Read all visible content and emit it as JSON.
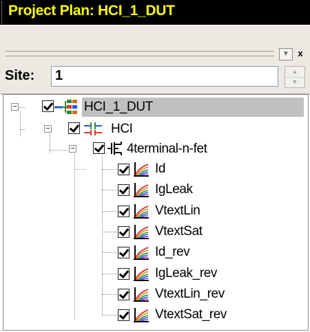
{
  "window": {
    "title": "Project Plan: HCI_1_DUT"
  },
  "dock": {
    "pin_glyph": "▼",
    "close_glyph": "x"
  },
  "site": {
    "label": "Site:",
    "value": "1"
  },
  "tree": {
    "root": {
      "label": "HCI_1_DUT",
      "checked": true,
      "expanded": true,
      "icon": "project-tree-icon"
    },
    "child": {
      "label": "HCI",
      "checked": true,
      "expanded": true,
      "icon": "module-icon"
    },
    "device": {
      "label": "4terminal-n-fet",
      "checked": true,
      "expanded": true,
      "icon": "transistor-icon"
    },
    "tests": [
      {
        "label": "Id",
        "checked": true,
        "icon": "curve-plot-icon"
      },
      {
        "label": "IgLeak",
        "checked": true,
        "icon": "curve-plot-icon"
      },
      {
        "label": "VtextLin",
        "checked": true,
        "icon": "curve-plot-icon"
      },
      {
        "label": "VtextSat",
        "checked": true,
        "icon": "curve-plot-icon"
      },
      {
        "label": "Id_rev",
        "checked": true,
        "icon": "curve-plot-icon"
      },
      {
        "label": "IgLeak_rev",
        "checked": true,
        "icon": "curve-plot-icon"
      },
      {
        "label": "VtextLin_rev",
        "checked": true,
        "icon": "curve-plot-icon"
      },
      {
        "label": "VtextSat_rev",
        "checked": true,
        "icon": "curve-plot-icon"
      }
    ]
  },
  "colors": {
    "title_bg": "#000000",
    "title_fg": "#ffff00",
    "selection_bg": "#c0c0c0",
    "panel_bg": "#ece9e3"
  }
}
